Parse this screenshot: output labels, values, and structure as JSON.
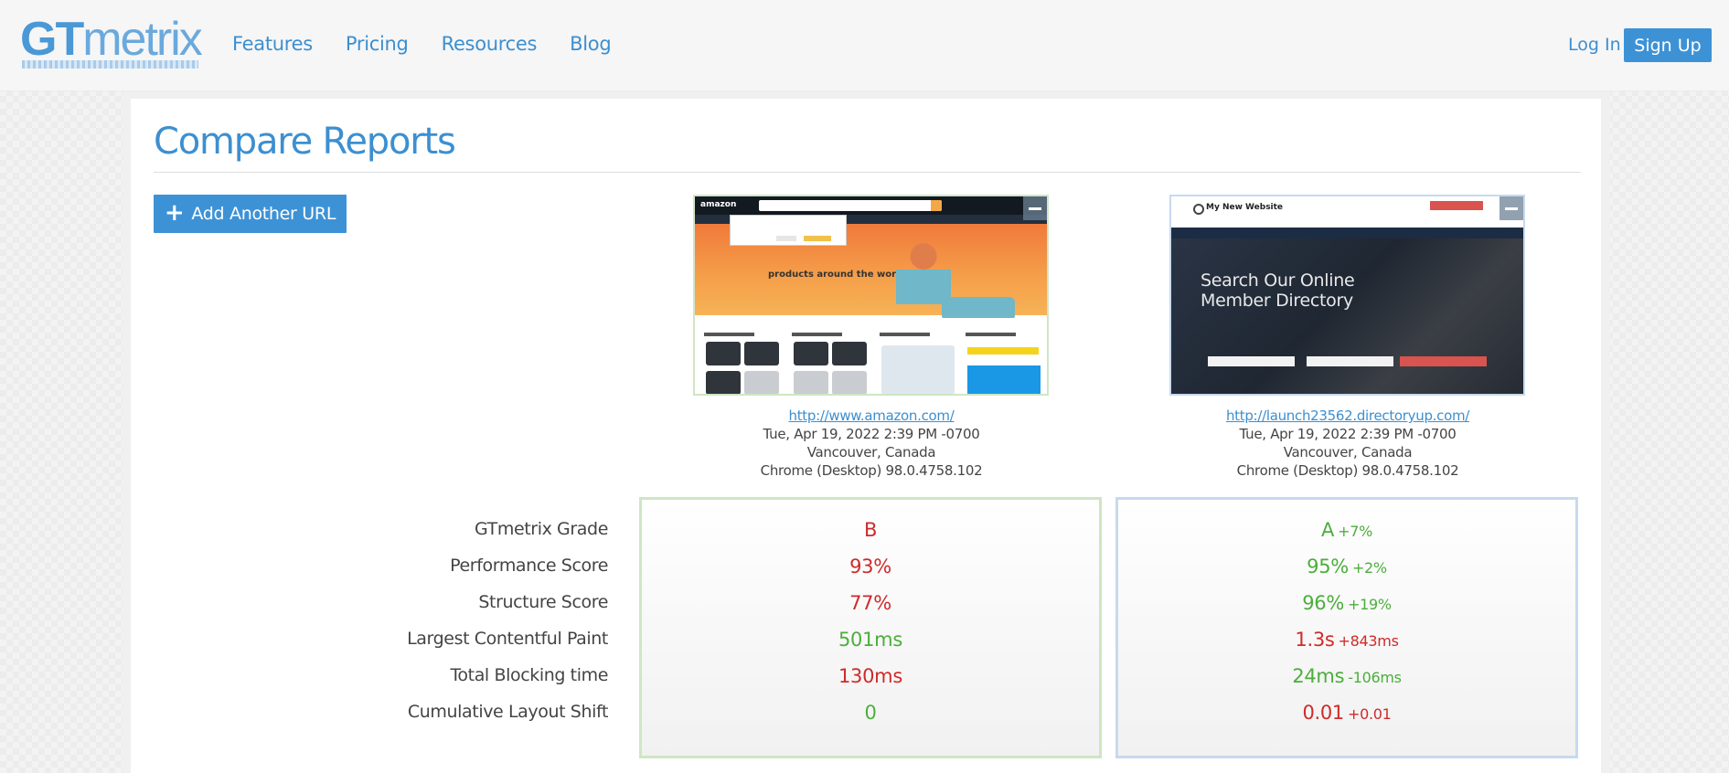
{
  "header": {
    "logo_gt": "GT",
    "logo_metrix": "metrix",
    "nav": [
      "Features",
      "Pricing",
      "Resources",
      "Blog"
    ],
    "login": "Log In",
    "signup": "Sign Up"
  },
  "page": {
    "title": "Compare Reports",
    "add_url_label": "Add Another URL"
  },
  "reports": [
    {
      "url": "http://www.amazon.com/",
      "datetime": "Tue, Apr 19, 2022 2:39 PM -0700",
      "location": "Vancouver, Canada",
      "browser": "Chrome (Desktop) 98.0.4758.102",
      "preview": {
        "logo": "amazon",
        "hero_text": "products around the world"
      },
      "border_color": "#cfe6c4"
    },
    {
      "url": "http://launch23562.directoryup.com/",
      "datetime": "Tue, Apr 19, 2022 2:39 PM -0700",
      "location": "Vancouver, Canada",
      "browser": "Chrome (Desktop) 98.0.4758.102",
      "preview": {
        "site_name": "My New Website",
        "hero_line1": "Search Our Online",
        "hero_line2": "Member Directory"
      },
      "border_color": "#c7d9ee"
    }
  ],
  "metrics": {
    "labels": [
      "GTmetrix Grade",
      "Performance Score",
      "Structure Score",
      "Largest Contentful Paint",
      "Total Blocking time",
      "Cumulative Layout Shift"
    ],
    "left": [
      {
        "value": "B",
        "status": "bad"
      },
      {
        "value": "93%",
        "status": "bad"
      },
      {
        "value": "77%",
        "status": "bad"
      },
      {
        "value": "501ms",
        "status": "good"
      },
      {
        "value": "130ms",
        "status": "bad"
      },
      {
        "value": "0",
        "status": "good"
      }
    ],
    "right": [
      {
        "value": "A",
        "delta": "+7%",
        "status": "good"
      },
      {
        "value": "95%",
        "delta": "+2%",
        "status": "good"
      },
      {
        "value": "96%",
        "delta": "+19%",
        "status": "good"
      },
      {
        "value": "1.3s",
        "delta": "+843ms",
        "status": "bad"
      },
      {
        "value": "24ms",
        "delta": "-106ms",
        "status": "good"
      },
      {
        "value": "0.01",
        "delta": "+0.01",
        "status": "bad"
      }
    ]
  },
  "colors": {
    "accent": "#3d92d6",
    "good": "#4cae3c",
    "bad": "#d02a2a"
  }
}
